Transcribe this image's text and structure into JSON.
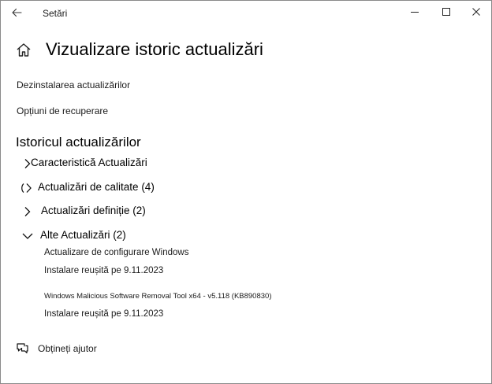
{
  "window": {
    "app_title": "Setări",
    "icons": {
      "back": "back-arrow-icon",
      "minimize": "minimize-icon",
      "maximize": "maximize-icon",
      "close": "close-icon"
    }
  },
  "header": {
    "home_icon": "home-icon",
    "page_title": "Vizualizare istoric actualizări"
  },
  "links": {
    "uninstall": "Dezinstalarea actualizărilor",
    "recovery": "Opțiuni de recuperare"
  },
  "history": {
    "section_title": "Istoricul actualizărilor",
    "groups": [
      {
        "label": "Caracteristică Actualizări",
        "expanded": false
      },
      {
        "label": "Actualizări de calitate (4)",
        "expanded": false
      },
      {
        "label": "Actualizări definiție (2)",
        "expanded": false
      },
      {
        "label": "Alte Actualizări (2)",
        "expanded": true,
        "items": [
          {
            "name": "Actualizare de configurare Windows",
            "status": "Instalare reușită pe 9.11.2023"
          },
          {
            "name": "Windows Malicious Software Removal Tool x64 - v5.118 (KB890830)",
            "status": "Instalare reușită pe 9.11.2023"
          }
        ]
      }
    ]
  },
  "footer": {
    "help_icon": "help-chat-icon",
    "help_label": "Obțineți ajutor"
  },
  "colors": {
    "background": "#ffffff",
    "text": "#1a1a1a",
    "window_border": "#8a8a8a"
  }
}
